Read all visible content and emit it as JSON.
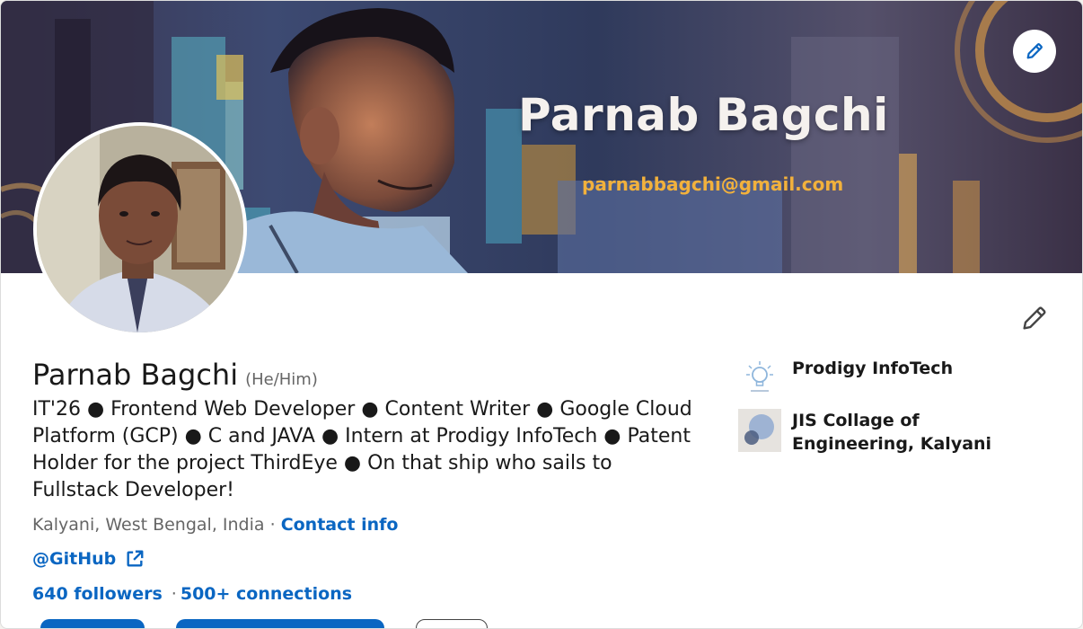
{
  "banner": {
    "name": "Parnab Bagchi",
    "email": "parnabbagchi@gmail.com"
  },
  "profile": {
    "name": "Parnab Bagchi",
    "pronouns": "(He/Him)",
    "headline": "IT'26 ● Frontend Web Developer ● Content Writer ● Google Cloud Platform (GCP) ● C and JAVA ● Intern at Prodigy InfoTech ● Patent Holder for the project ThirdEye ● On that ship who sails to Fullstack Developer!",
    "location": "Kalyani, West Bengal, India",
    "separator": "·",
    "contact_label": "Contact info",
    "github_label": "@GitHub",
    "followers_label": "640 followers",
    "connections_label": "500+ connections"
  },
  "organizations": [
    {
      "name": "Prodigy InfoTech",
      "logo": "lightbulb-logo"
    },
    {
      "name": "JIS Collage of Engineering, Kalyani",
      "logo": "circles-logo"
    }
  ],
  "icons": {
    "banner_edit": "pencil-icon",
    "intro_edit": "pencil-icon",
    "external_link": "external-link-icon"
  },
  "colors": {
    "link": "#0a66c2",
    "text": "#191919",
    "muted": "#666666",
    "banner_email": "#f2b13c"
  }
}
